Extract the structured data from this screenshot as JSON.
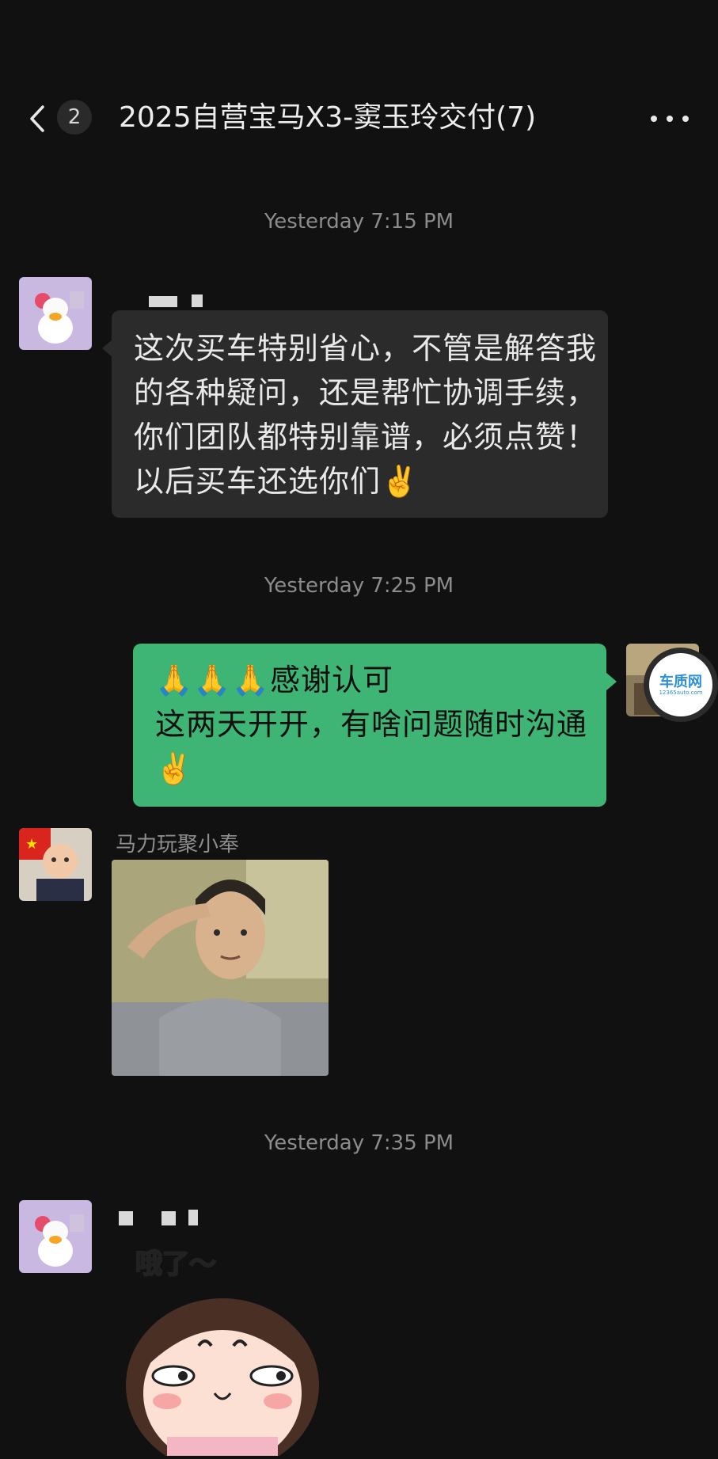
{
  "header": {
    "back_badge": "2",
    "title": "2025自营宝马X3-窦玉玲交付(7)"
  },
  "messages": [
    {
      "type": "timestamp",
      "text": "Yesterday 7:15 PM"
    },
    {
      "type": "text",
      "from": "other",
      "text": "这次买车特别省心，不管是解答我\n的各种疑问，还是帮忙协调手续，\n你们团队都特别靠谱，必须点赞！\n以后买车还选你们✌️"
    },
    {
      "type": "timestamp",
      "text": "Yesterday 7:25 PM"
    },
    {
      "type": "text",
      "from": "self",
      "text": "🙏🙏🙏感谢认可\n这两天开开，有啥问题随时沟通\n✌️"
    },
    {
      "type": "image",
      "from": "other",
      "sender": "马力玩聚小奉"
    },
    {
      "type": "timestamp",
      "text": "Yesterday 7:35 PM"
    },
    {
      "type": "sticker",
      "from": "other",
      "text": "哦了～"
    }
  ],
  "watermark": {
    "logo_text": "车质网",
    "logo_subtext": "12365auto.com"
  },
  "colors": {
    "background": "#111111",
    "bubble_self": "#3eb575",
    "bubble_other": "#2b2b2b",
    "timestamp": "#8c8c8c"
  }
}
